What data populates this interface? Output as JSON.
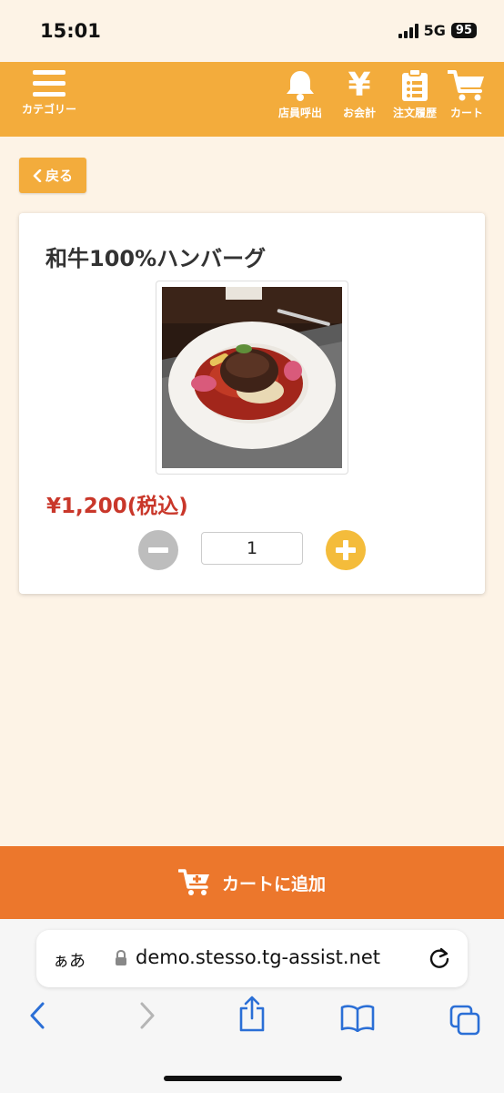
{
  "status_bar": {
    "time": "15:01",
    "network": "5G",
    "battery": "95"
  },
  "header": {
    "category_label": "カテゴリー",
    "call_staff_label": "店員呼出",
    "bill_label": "お会計",
    "order_history_label": "注文履歴",
    "cart_label": "カート",
    "yen_symbol": "¥"
  },
  "back_button": {
    "label": "戻る"
  },
  "product": {
    "name": "和牛100%ハンバーグ",
    "price": "¥1,200(税込)",
    "quantity": "1"
  },
  "add_to_cart": {
    "label": "カートに追加"
  },
  "browser": {
    "aa_label": "ぁあ",
    "url": "demo.stesso.tg-assist.net"
  },
  "colors": {
    "header": "#f3ac3c",
    "add_to_cart": "#ec772c",
    "price": "#c9372a",
    "plus": "#f4bc3b",
    "minus": "#bdbdbd",
    "page_bg": "#fdf3e6"
  }
}
